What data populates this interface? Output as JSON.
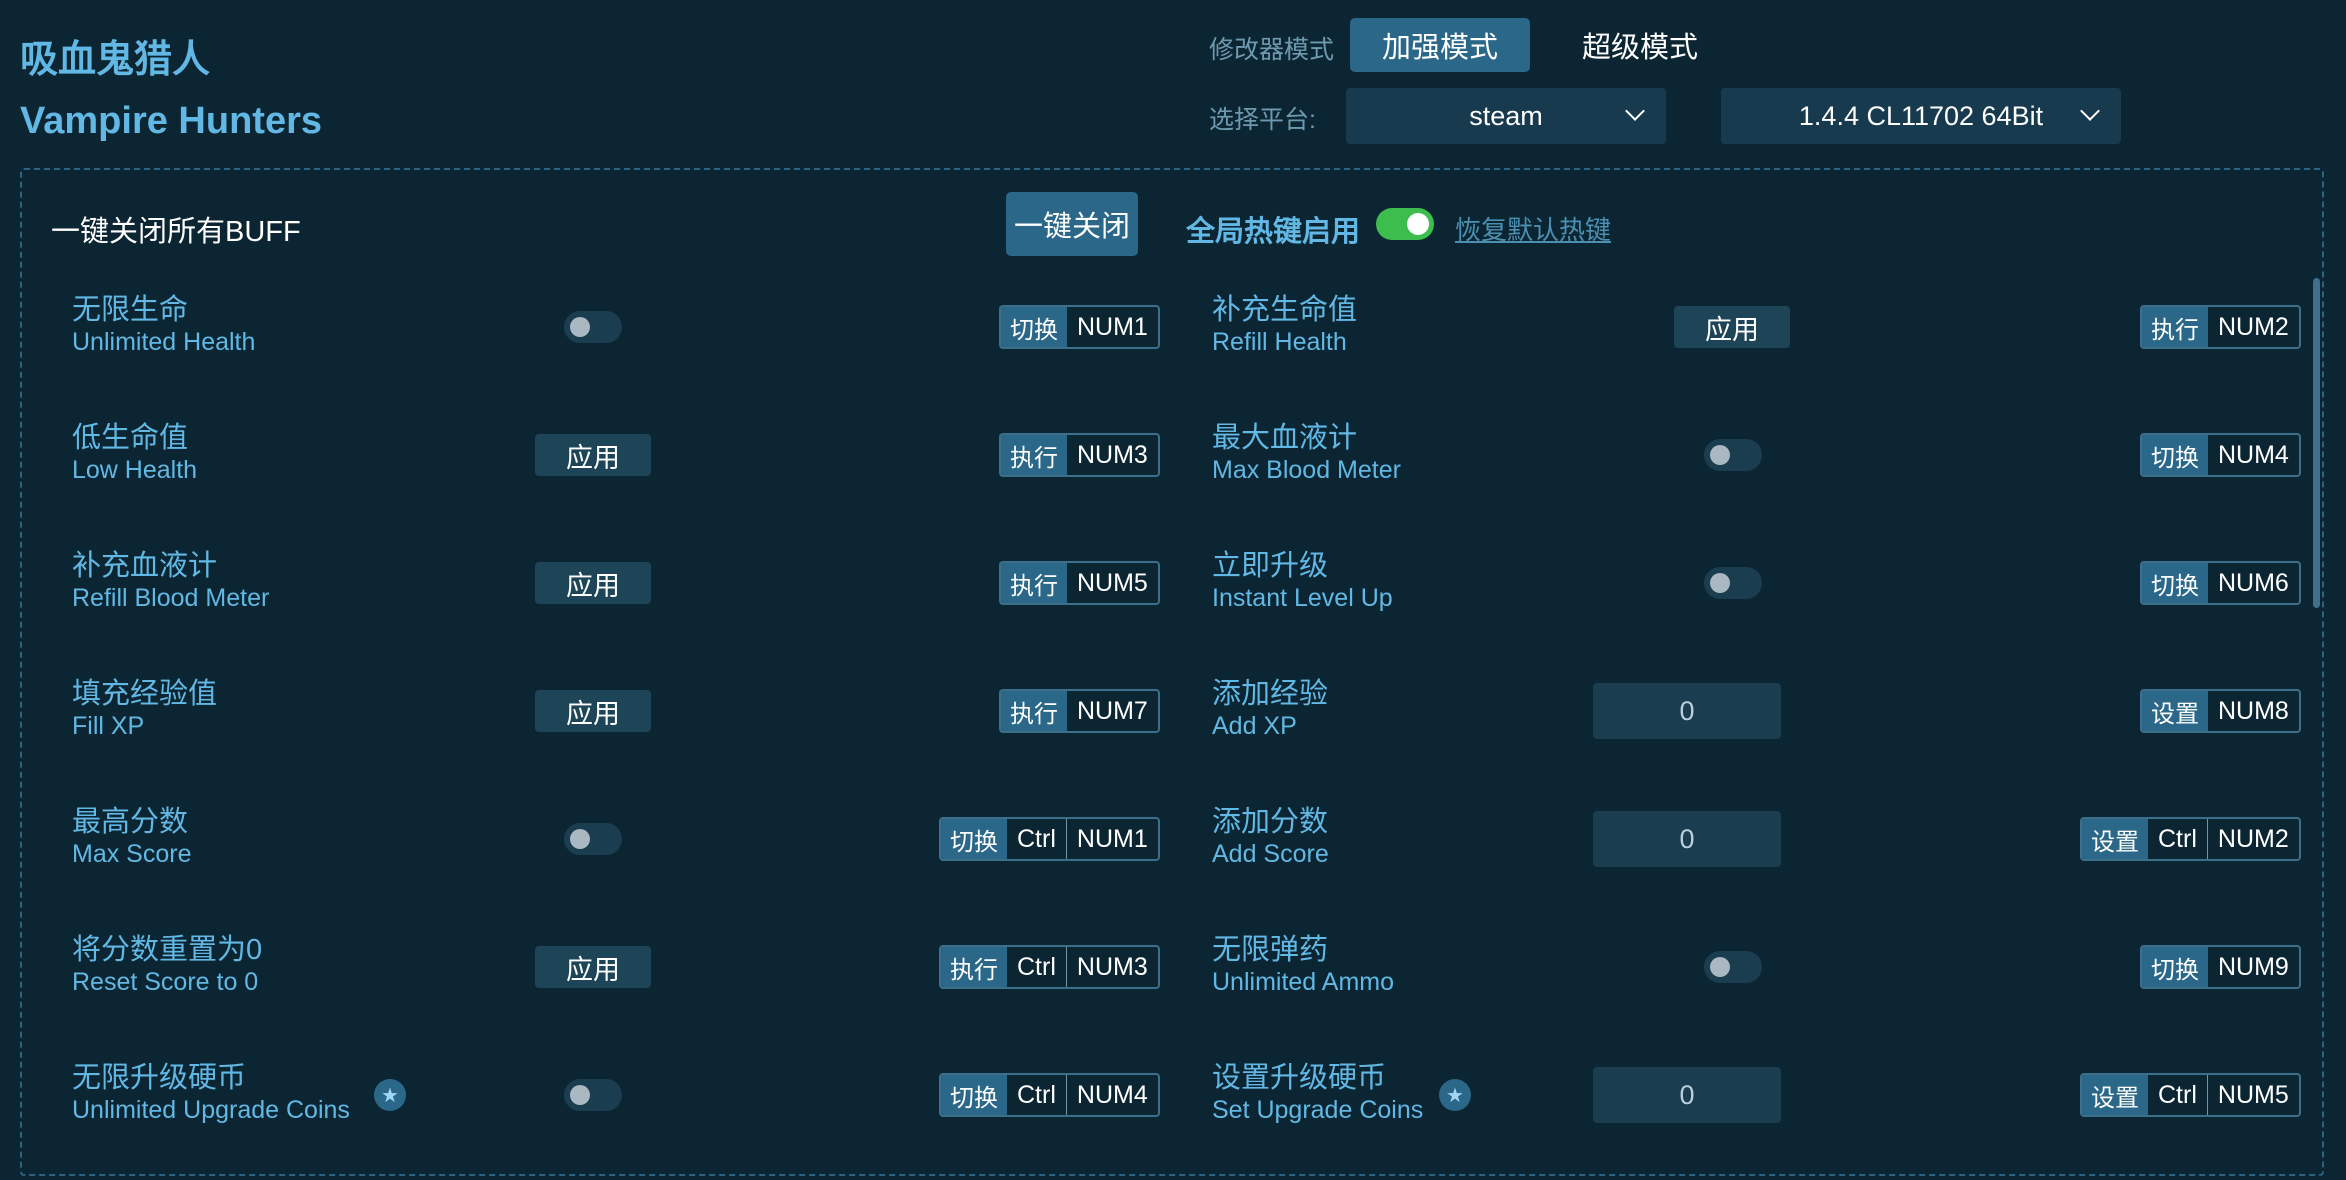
{
  "header": {
    "title_cn": "吸血鬼猎人",
    "title_en": "Vampire Hunters",
    "mode_label": "修改器模式",
    "mode_enhanced": "加强模式",
    "mode_super": "超级模式",
    "platform_label": "选择平台:",
    "platform_value": "steam",
    "version_value": "1.4.4 CL11702 64Bit"
  },
  "toolbar": {
    "buff_label": "一键关闭所有BUFF",
    "close_all": "一键关闭",
    "global_hotkey_label": "全局热键启用",
    "global_hotkey_enabled": true,
    "restore_hotkeys": "恢复默认热键"
  },
  "items": [
    {
      "cn": "无限生命",
      "en": "Unlimited Health",
      "control": "toggle",
      "value": false,
      "action": "切换",
      "keys": [
        "NUM1"
      ]
    },
    {
      "cn": "补充生命值",
      "en": "Refill Health",
      "control": "apply",
      "label": "应用",
      "action": "执行",
      "keys": [
        "NUM2"
      ]
    },
    {
      "cn": "低生命值",
      "en": "Low Health",
      "control": "apply",
      "label": "应用",
      "action": "执行",
      "keys": [
        "NUM3"
      ]
    },
    {
      "cn": "最大血液计",
      "en": "Max Blood Meter",
      "control": "toggle",
      "value": false,
      "action": "切换",
      "keys": [
        "NUM4"
      ]
    },
    {
      "cn": "补充血液计",
      "en": "Refill Blood Meter",
      "control": "apply",
      "label": "应用",
      "action": "执行",
      "keys": [
        "NUM5"
      ]
    },
    {
      "cn": "立即升级",
      "en": "Instant Level Up",
      "control": "toggle",
      "value": false,
      "action": "切换",
      "keys": [
        "NUM6"
      ]
    },
    {
      "cn": "填充经验值",
      "en": "Fill XP",
      "control": "apply",
      "label": "应用",
      "action": "执行",
      "keys": [
        "NUM7"
      ]
    },
    {
      "cn": "添加经验",
      "en": "Add XP",
      "control": "input",
      "value": "0",
      "action": "设置",
      "keys": [
        "NUM8"
      ]
    },
    {
      "cn": "最高分数",
      "en": "Max Score",
      "control": "toggle",
      "value": false,
      "action": "切换",
      "keys": [
        "Ctrl",
        "NUM1"
      ]
    },
    {
      "cn": "添加分数",
      "en": "Add Score",
      "control": "input",
      "value": "0",
      "action": "设置",
      "keys": [
        "Ctrl",
        "NUM2"
      ]
    },
    {
      "cn": "将分数重置为0",
      "en": "Reset Score to 0",
      "control": "apply",
      "label": "应用",
      "action": "执行",
      "keys": [
        "Ctrl",
        "NUM3"
      ]
    },
    {
      "cn": "无限弹药",
      "en": "Unlimited Ammo",
      "control": "toggle",
      "value": false,
      "action": "切换",
      "keys": [
        "NUM9"
      ]
    },
    {
      "cn": "无限升级硬币",
      "en": "Unlimited Upgrade Coins",
      "control": "toggle",
      "value": false,
      "star": true,
      "action": "切换",
      "keys": [
        "Ctrl",
        "NUM4"
      ]
    },
    {
      "cn": "设置升级硬币",
      "en": "Set Upgrade Coins",
      "control": "input",
      "value": "0",
      "star": true,
      "action": "设置",
      "keys": [
        "Ctrl",
        "NUM5"
      ]
    }
  ]
}
